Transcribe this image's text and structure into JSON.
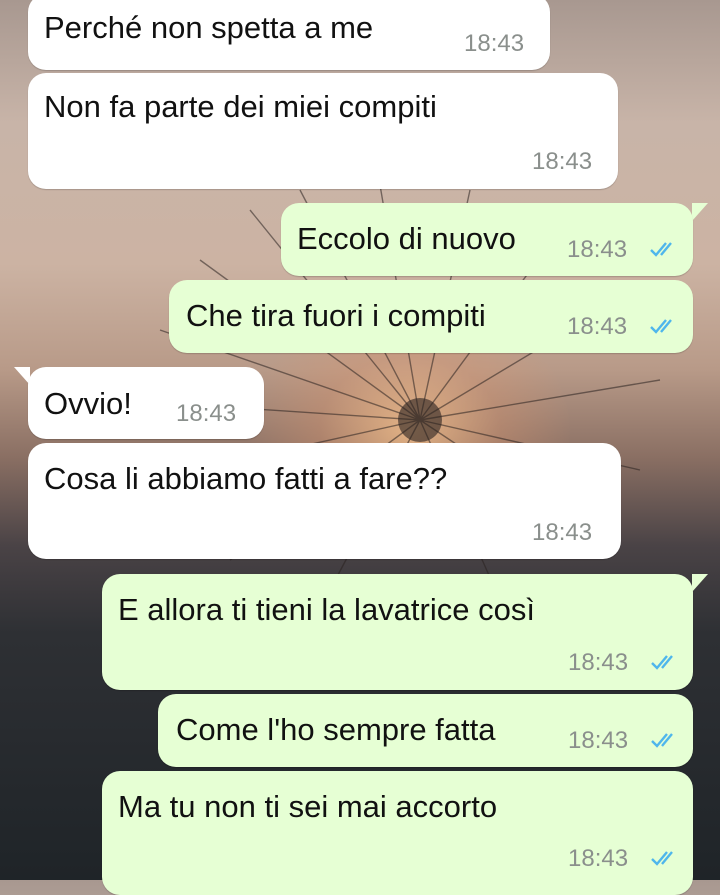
{
  "chat": {
    "messages": [
      {
        "direction": "incoming",
        "text": "Perché non spetta a me",
        "time": "18:43"
      },
      {
        "direction": "incoming",
        "text": "Non fa parte dei miei compiti",
        "time": "18:43"
      },
      {
        "direction": "outgoing",
        "text": "Eccolo di nuovo",
        "time": "18:43",
        "status": "read"
      },
      {
        "direction": "outgoing",
        "text": "Che tira fuori i compiti",
        "time": "18:43",
        "status": "read"
      },
      {
        "direction": "incoming",
        "text": "Ovvio!",
        "time": "18:43"
      },
      {
        "direction": "incoming",
        "text": "Cosa li abbiamo fatti a fare??",
        "time": "18:43"
      },
      {
        "direction": "outgoing",
        "text": "E allora ti tieni la lavatrice così",
        "time": "18:43",
        "status": "read"
      },
      {
        "direction": "outgoing",
        "text": "Come l'ho sempre fatta",
        "time": "18:43",
        "status": "read"
      },
      {
        "direction": "outgoing",
        "text": "Ma tu non ti sei mai accorto",
        "time": "18:43",
        "status": "read"
      }
    ]
  },
  "colors": {
    "incoming_bubble": "#ffffff",
    "outgoing_bubble": "#e6ffd4",
    "read_ticks": "#4fb6ec",
    "timestamp": "#8a8f8c"
  },
  "icons": {
    "read_status": "double-check-icon"
  }
}
